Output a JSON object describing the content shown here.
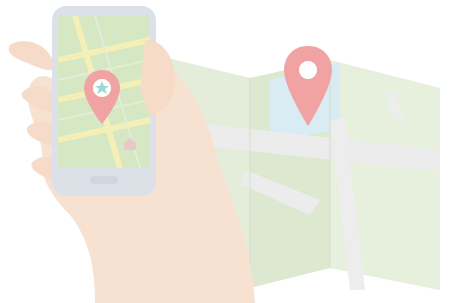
{
  "illustration": {
    "subject": "hand-holding-phone-with-map",
    "colors": {
      "background": "#ffffff",
      "paper_map_green": "#dfe9d3",
      "paper_map_light": "#eef3e6",
      "paper_map_road": "#e8ebe7",
      "water": "#d9ecf3",
      "pin_red": "#f1a3a3",
      "pin_teal": "#9fd8d6",
      "phone_body": "#d9dfe5",
      "phone_screen_green": "#d5e7c3",
      "phone_screen_roads": "#f4eeb7",
      "skin": "#f6dcc8",
      "skin_shadow": "#efcdb7"
    },
    "icons": [
      "map-pin-icon",
      "star-pin-icon",
      "house-icon"
    ]
  }
}
